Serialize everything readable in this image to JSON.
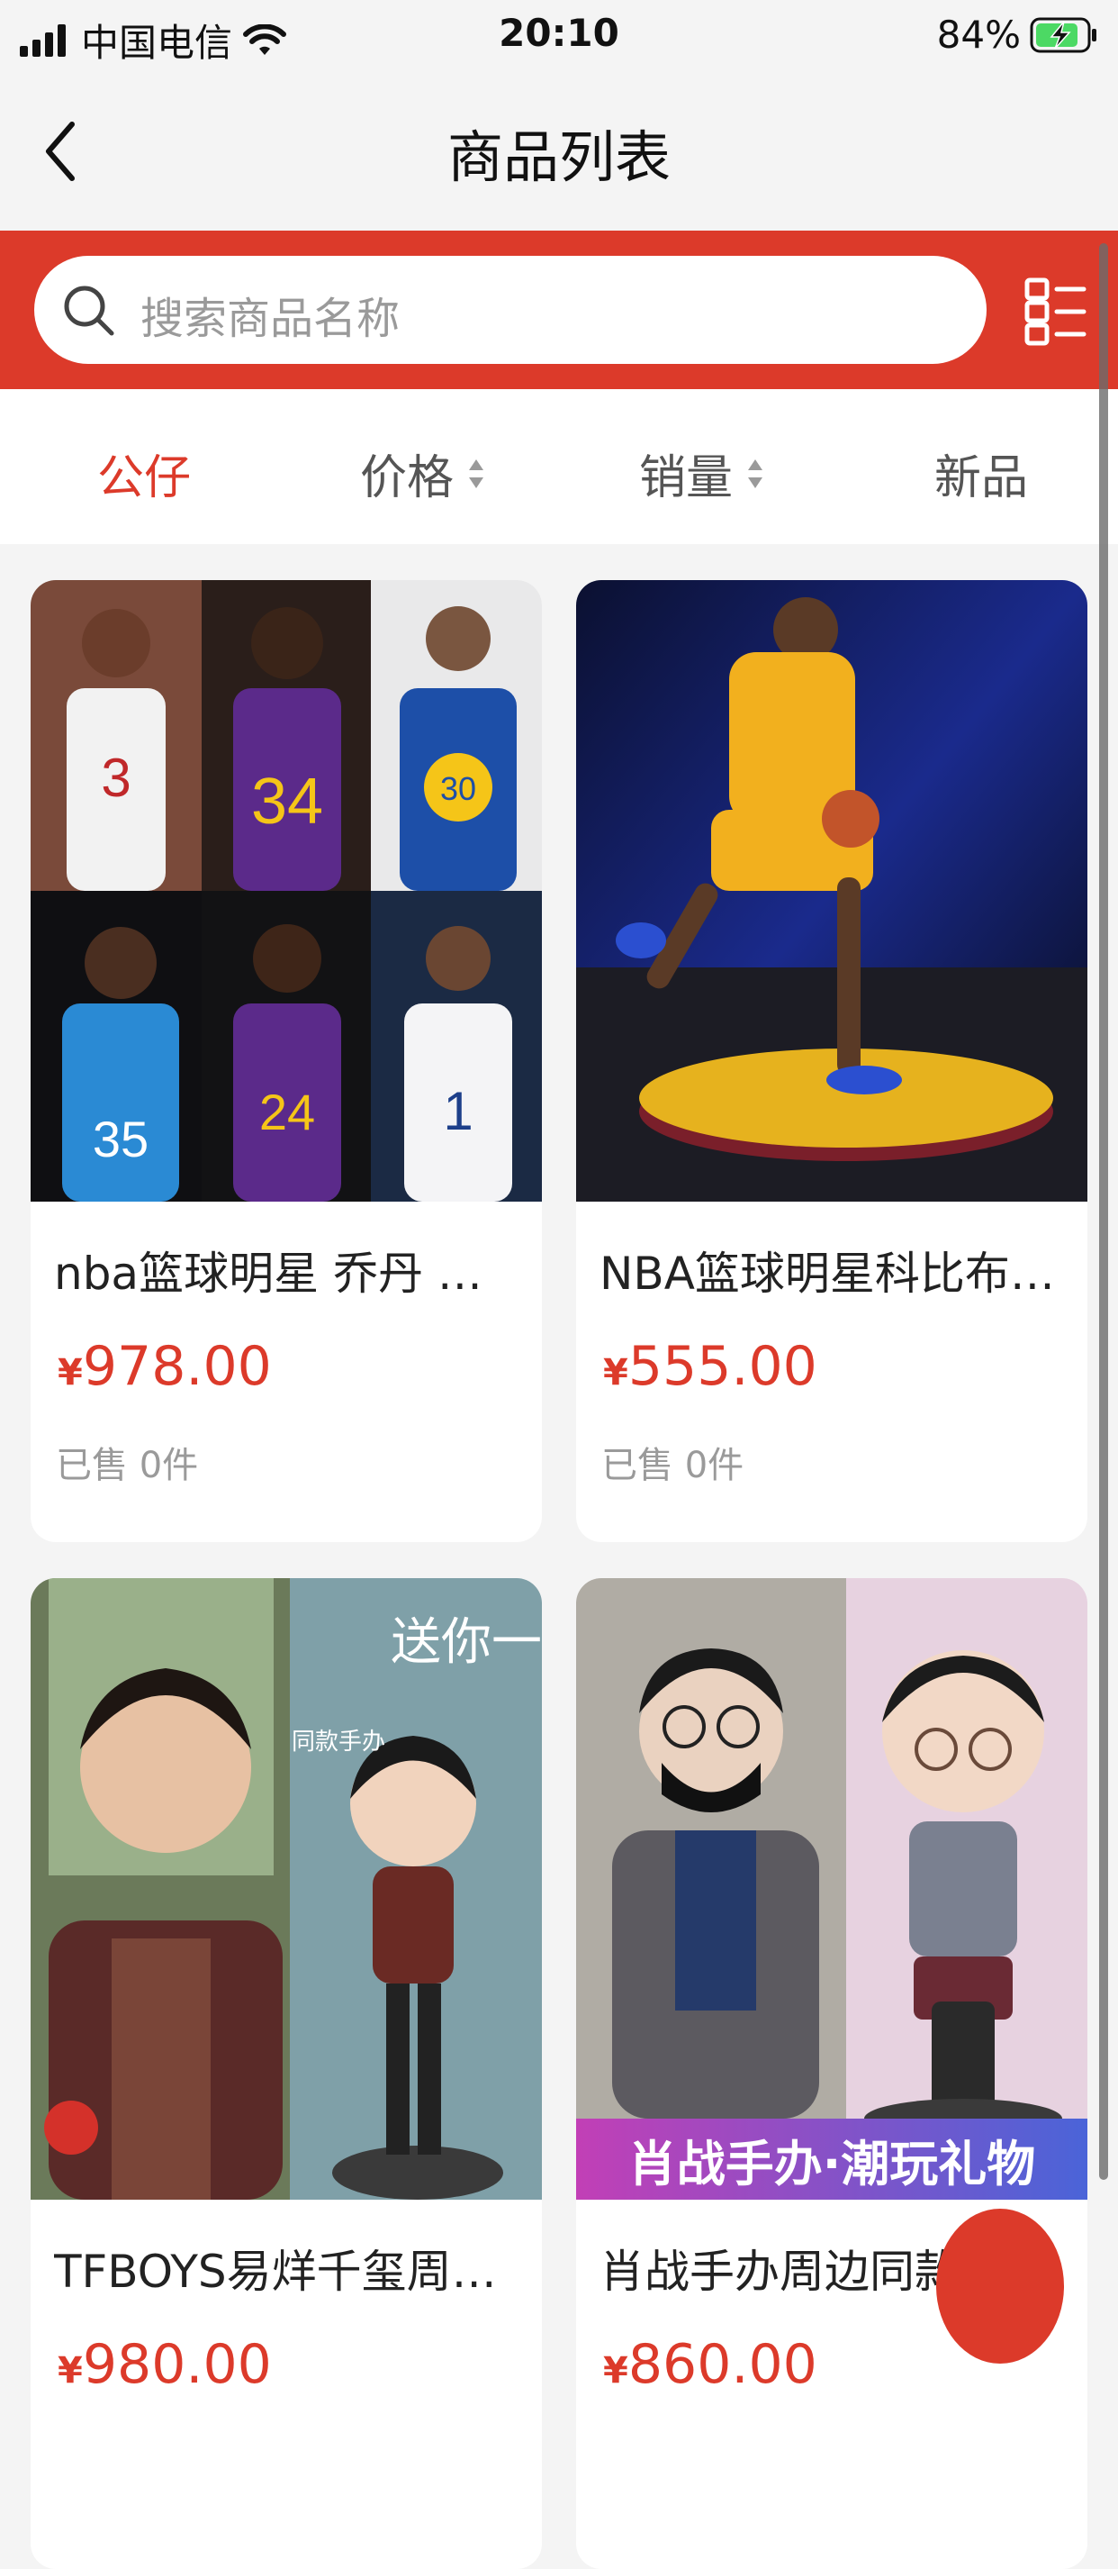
{
  "status_bar": {
    "carrier": "中国电信",
    "time": "20:10",
    "battery": "84%"
  },
  "nav": {
    "title": "商品列表"
  },
  "search": {
    "placeholder": "搜索商品名称"
  },
  "filters": [
    {
      "label": "公仔"
    },
    {
      "label": "价格"
    },
    {
      "label": "销量"
    },
    {
      "label": "新品"
    }
  ],
  "products": [
    {
      "name": "nba篮球明星 乔丹 科比库里詹姆斯",
      "currency": "¥",
      "price": "978.00",
      "sold": "已售 0件"
    },
    {
      "name": "NBA篮球明星科比布莱恩特手办摆件",
      "currency": "¥",
      "price": "555.00",
      "sold": "已售 0件"
    },
    {
      "name": "TFBOYS易烊千玺周边手办公仔",
      "currency": "¥",
      "price": "980.00",
      "sold": ""
    },
    {
      "name": "肖战手办周边同款公仔",
      "currency": "¥",
      "price": "860.00",
      "sold": "",
      "banner": "肖战手办·潮玩礼物"
    }
  ],
  "colors": {
    "accent": "#dc3a2a",
    "background": "#f4f4f4",
    "muted_text": "#9a9a9a"
  }
}
